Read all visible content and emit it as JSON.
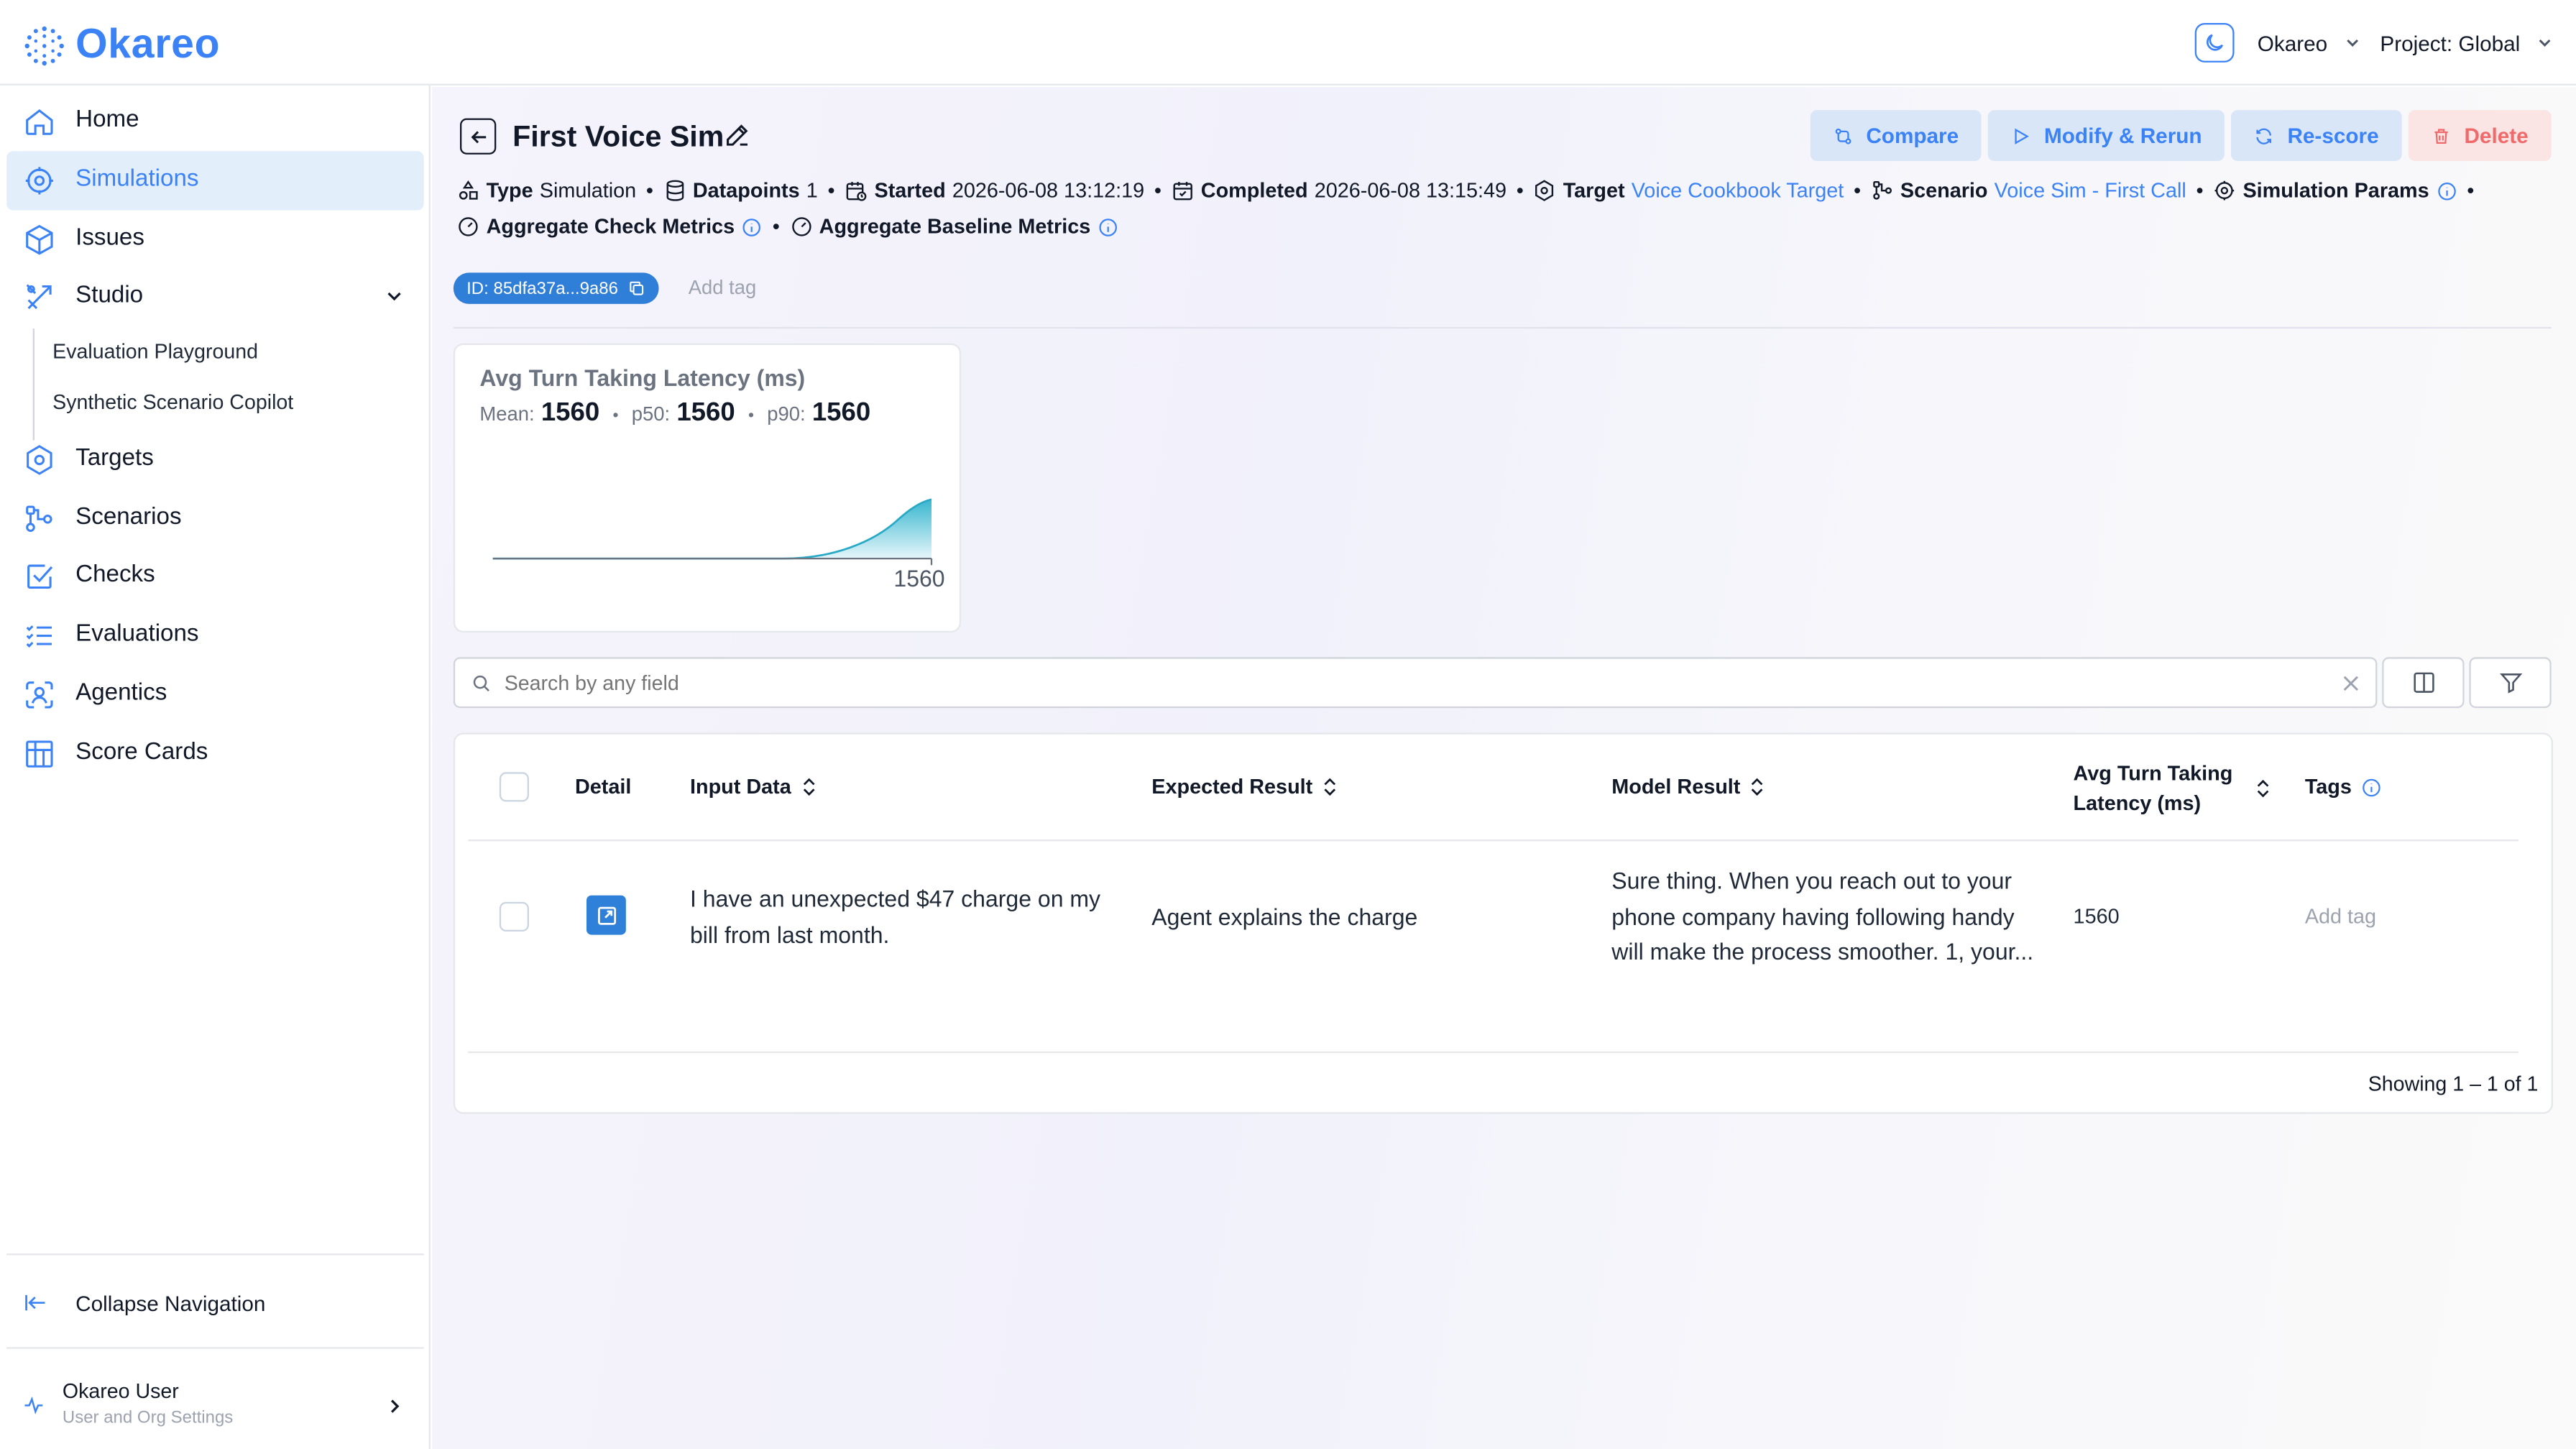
{
  "brand": {
    "name": "Okareo",
    "accent": "#3b82f6"
  },
  "topbar": {
    "org": "Okareo",
    "project": "Project: Global"
  },
  "sidebar": {
    "items": [
      {
        "label": "Home",
        "icon": "home-icon"
      },
      {
        "label": "Simulations",
        "icon": "simulations-icon",
        "active": true
      },
      {
        "label": "Issues",
        "icon": "cube-icon"
      },
      {
        "label": "Studio",
        "icon": "studio-icon"
      },
      {
        "label": "Targets",
        "icon": "hexagon-icon"
      },
      {
        "label": "Scenarios",
        "icon": "scenarios-icon"
      },
      {
        "label": "Checks",
        "icon": "check-square-icon"
      },
      {
        "label": "Evaluations",
        "icon": "list-check-icon"
      },
      {
        "label": "Agentics",
        "icon": "agent-icon"
      },
      {
        "label": "Score Cards",
        "icon": "table-icon"
      }
    ],
    "studio_sub": [
      "Evaluation Playground",
      "Synthetic Scenario Copilot"
    ],
    "collapse_label": "Collapse Navigation",
    "user": {
      "name": "Okareo User",
      "sub": "User and Org Settings"
    }
  },
  "page": {
    "title": "First Voice Sim",
    "actions": {
      "compare": "Compare",
      "modify": "Modify & Rerun",
      "rescore": "Re-score",
      "delete": "Delete"
    },
    "meta": {
      "type_label": "Type",
      "type_value": "Simulation",
      "datapoints_label": "Datapoints",
      "datapoints_value": "1",
      "started_label": "Started",
      "started_value": "2026-06-08 13:12:19",
      "completed_label": "Completed",
      "completed_value": "2026-06-08 13:15:49",
      "target_label": "Target",
      "target_value": "Voice Cookbook Target",
      "scenario_label": "Scenario",
      "scenario_value": "Voice Sim - First Call",
      "params_label": "Simulation Params",
      "agg_check": "Aggregate Check Metrics",
      "agg_baseline": "Aggregate Baseline Metrics"
    },
    "id_tag": "ID: 85dfa37a...9a86",
    "add_tag": "Add tag"
  },
  "metric_card": {
    "title": "Avg Turn Taking Latency (ms)",
    "mean_label": "Mean:",
    "mean_value": "1560",
    "p50_label": "p50:",
    "p50_value": "1560",
    "p90_label": "p90:",
    "p90_value": "1560",
    "x_tick": "1560"
  },
  "search": {
    "placeholder": "Search by any field"
  },
  "table": {
    "headers": {
      "detail": "Detail",
      "input": "Input Data",
      "expected": "Expected Result",
      "model": "Model Result",
      "latency_line1": "Avg Turn Taking",
      "latency_line2": "Latency (ms)",
      "tags": "Tags"
    },
    "rows": [
      {
        "input_line1": "I have an unexpected $47 charge on my",
        "input_line2": "bill from last month.",
        "expected": "Agent explains the charge",
        "model_line1": "Sure thing. When you reach out to your",
        "model_line2": "phone company having following handy",
        "model_line3": "will make the process smoother. 1, your...",
        "latency": "1560",
        "tags": "Add tag"
      }
    ],
    "footer": "Showing 1 – 1 of 1"
  }
}
